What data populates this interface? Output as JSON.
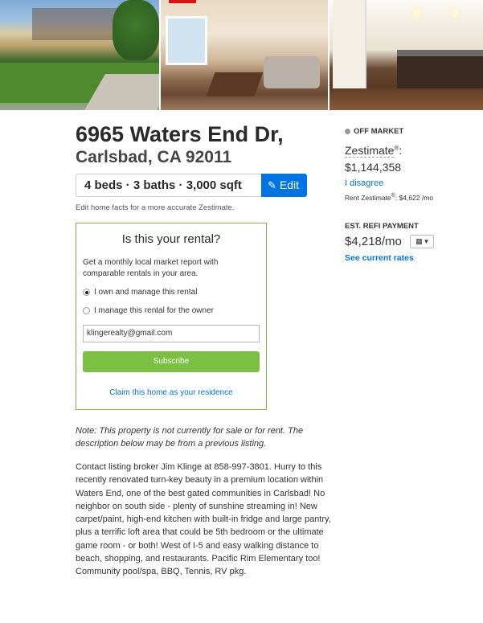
{
  "photos": {
    "items": [
      {
        "name": "exterior-photo"
      },
      {
        "name": "living-room-photo"
      },
      {
        "name": "kitchen-photo"
      }
    ]
  },
  "listing": {
    "address_line1": "6965 Waters End Dr,",
    "address_line2": "Carlsbad, CA 92011",
    "facts": "4 beds · 3 baths · 3,000 sqft",
    "edit_label": "Edit",
    "edit_note": "Edit home facts for a more accurate Zestimate."
  },
  "rental_card": {
    "title": "Is this your rental?",
    "description": "Get a monthly local market report with comparable rentals in your area.",
    "options": [
      {
        "label": "I own and manage this rental",
        "selected": true
      },
      {
        "label": "I manage this rental for the owner",
        "selected": false
      }
    ],
    "email_value": "klingerealty@gmail.com",
    "subscribe_label": "Subscribe",
    "claim_label": "Claim this home as your residence",
    "accent_color": "#7ac043"
  },
  "notes": {
    "note": "Note: This property is not currently for sale or for rent. The description below may be from a previous listing.",
    "description": "Contact listing broker Jim Klinge at 858-997-3801. Hurry to this recently renovated turn-key beauty in a premium location within Waters End, one of the best gated communities in Carlsbad! No neighbor on south side - plenty of sunshine streaming in! New carpet/paint, high-end kitchen with built-in fridge and large pantry, plus a terrific loft area that could be 5th bedroom or the ultimate game room - or both! West of I-5 and easy walking distance to beach, shopping, and restaurants. Pacific Rim Elementary too! Community pool/spa, BBQ, Tennis, RV pkg."
  },
  "sidebar": {
    "status": "OFF MARKET",
    "zestimate_label": "Zestimate",
    "zestimate_mark": "®",
    "zestimate_value": "$1,144,358",
    "disagree_label": "I disagree",
    "rent_zestimate_label": "Rent Zestimate",
    "rent_zestimate_mark": "®",
    "rent_zestimate_value": ": $4,622 /mo",
    "refi_label": "EST. REFI PAYMENT",
    "refi_value": "$4,218/mo",
    "calc_icon": "calculator-icon",
    "rates_label": "See current rates",
    "link_color": "#0074e4"
  }
}
